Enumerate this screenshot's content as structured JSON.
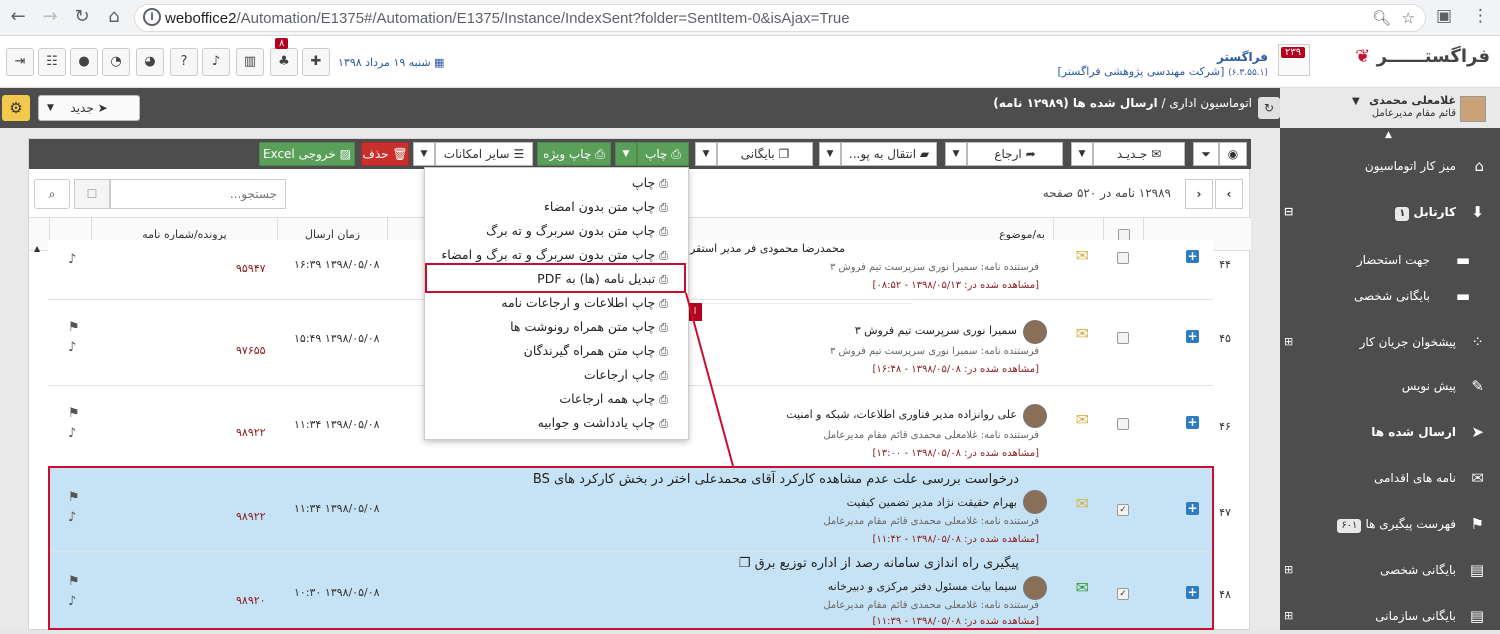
{
  "browser": {
    "url_host": "weboffice2",
    "url_path": "/Automation/E1375#/Automation/E1375/Instance/IndexSent?folder=SentItem-0&isAjax=True",
    "info_icon": "info-icon"
  },
  "header": {
    "notif_count": "۸",
    "date": "شنبه ۱۹ مرداد ۱۳۹۸",
    "app_name": "فراگستر",
    "company": "[شرکت مهندسی پژوهشی فراگستر]",
    "version": "(۶.۳.۵۵.۱)",
    "logo_count": "۲۳۹",
    "logo_text": "فراگستــــــر"
  },
  "topbar": {
    "new_label": "جدید",
    "breadcrumb_root": "اتوماسیون اداری",
    "breadcrumb_sep": "/",
    "breadcrumb_current": "ارسال شده ها (۱۲۹۸۹ نامه)"
  },
  "sidebar": {
    "user_name": "غلامعلی محمدی",
    "user_role": "قائم مقام مدیرعامل",
    "items": [
      {
        "label": "میز کار اتوماسیون",
        "icon": "home-icon"
      },
      {
        "label": "کارتابل",
        "badge": "۱",
        "icon": "inbox-icon"
      },
      {
        "label": "جهت استحضار",
        "icon": "folder-icon"
      },
      {
        "label": "بایگانی شخصی",
        "icon": "folder-icon"
      },
      {
        "label": "پیشخوان جریان کار",
        "icon": "workflow-icon"
      },
      {
        "label": "پیش نویس",
        "icon": "edit-icon"
      },
      {
        "label": "ارسال شده ها",
        "icon": "send-icon"
      },
      {
        "label": "نامه های اقدامی",
        "icon": "mail-action-icon"
      },
      {
        "label": "فهرست پیگیری ها",
        "badge": "۶۰۱",
        "icon": "flag-icon"
      },
      {
        "label": "بایگانی شخصی",
        "icon": "archive-icon"
      },
      {
        "label": "بایگانی سازمانی",
        "icon": "archive-icon"
      }
    ]
  },
  "toolbar": {
    "excel": "خروجی Excel",
    "delete": "حذف",
    "more": "سایر امکانات",
    "special_print": "چاپ ویژه",
    "print": "چاپ",
    "archive": "بایگانی",
    "move": "انتقال به پو...",
    "refer": "ارجاع",
    "new": "جـدیـد"
  },
  "search": {
    "placeholder": "جستجو..."
  },
  "pager": {
    "info": "۱۲۹۸۹ نامه در ۵۲۰ صفحه"
  },
  "columns": {
    "subject": "به/موضوع",
    "time": "زمان ارسال",
    "number": "پرونده/شماره نامه"
  },
  "menu": [
    "چاپ",
    "چاپ متن بدون امضاء",
    "چاپ متن بدون سربرگ و ته برگ",
    "چاپ متن بدون سربرگ و ته برگ و امضاء",
    "تبدیل نامه (ها) به PDF",
    "چاپ اطلاعات و ارجاعات نامه",
    "چاپ متن همراه رونوشت ها",
    "چاپ متن همراه گیرندگان",
    "چاپ ارجاعات",
    "چاپ همه ارجاعات",
    "چاپ یادداشت و جوابیه"
  ],
  "rows": [
    {
      "n": "۴۴",
      "subject": "",
      "person": "محمدرضا محمودی فر مدیر استقرار و پیاده سازی",
      "sender": "فرستنده نامه:  سمیرا نوری سرپرست تیم فروش ۳",
      "seen": "[مشاهده شده در: ۱۳۹۸/۰۵/۱۳ - ۰۸:۵۲]",
      "time": "۱۳۹۸/۰۵/۰۸ ۱۶:۳۹",
      "num": "۹۵۹۴۷"
    },
    {
      "n": "۴۵",
      "subject": "",
      "person": "سمیرا نوری سرپرست تیم فروش ۳",
      "sender": "فرستنده نامه:  سمیرا نوری سرپرست تیم فروش ۳",
      "seen": "[مشاهده شده در: ۱۳۹۸/۰۵/۰۸ - ۱۶:۴۸]",
      "time": "۱۳۹۸/۰۵/۰۸ ۱۵:۴۹",
      "num": "۹۷۶۵۵"
    },
    {
      "n": "۴۶",
      "subject": "",
      "person": "علی روانزاده مدیر فناوری اطلاعات، شبکه و امنیت",
      "sender": "فرستنده نامه:  غلامعلی محمدی قائم مقام مدیرعامل",
      "seen": "[مشاهده شده در: ۱۳۹۸/۰۵/۰۸ - ۱۳:۰۰]",
      "time": "۱۳۹۸/۰۵/۰۸ ۱۱:۳۴",
      "num": "۹۸۹۲۲"
    },
    {
      "n": "۴۷",
      "subject": "درخواست بررسی علت عدم مشاهده کارکرد آقای محمدعلی اختر در بخش کارکرد های BS",
      "person": "بهرام حقیقت نژاد مدیر تضمین کیفیت",
      "sender": "فرستنده نامه:  غلامعلی محمدی قائم مقام مدیرعامل",
      "seen": "[مشاهده شده در: ۱۳۹۸/۰۵/۰۸ - ۱۱:۴۲]",
      "time": "۱۳۹۸/۰۵/۰۸ ۱۱:۳۴",
      "num": "۹۸۹۲۲"
    },
    {
      "n": "۴۸",
      "subject": "پیگیری راه اندازی سامانه رصد از اداره توزیع برق",
      "person": "سیما بیات مسئول دفتر مرکزی و دبیرخانه",
      "sender": "فرستنده نامه:  غلامعلی محمدی قائم مقام مدیرعامل",
      "seen": "[مشاهده شده در: ۱۳۹۸/۰۵/۰۸ - ۱۱:۳۹]",
      "time": "۱۳۹۸/۰۵/۰۸ ۱۰:۳۰",
      "num": "۹۸۹۲۰"
    }
  ],
  "tip_text": "ا"
}
